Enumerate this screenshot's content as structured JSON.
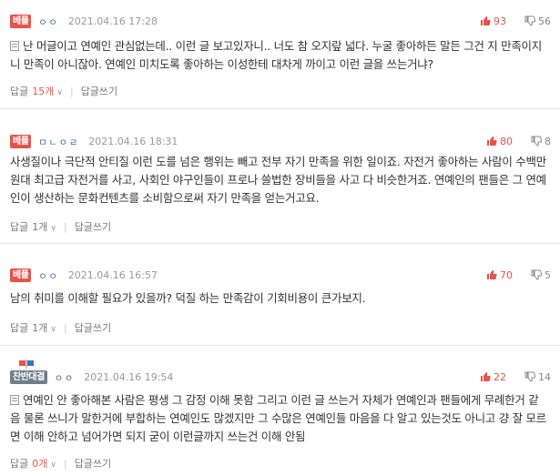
{
  "comments": [
    {
      "badge": "베플",
      "nick": "ㅇㅇ",
      "date": "2021.04.16 17:28",
      "up": "93",
      "down": "56",
      "text": "난 머글이고 연예인 관심없는데.. 이런 글 보고있자니.. 너도 참 오지랖 넓다. 누굴 좋아하든 말든 그건 지 만족이지 니 만족이 아니잖아. 연예인 미치도록 좋아하는 이성한테 대차게 까이고 이런 글을 쓰는거냐?",
      "reply_label": "답글",
      "reply_count": "15개",
      "write_label": "답글쓰기"
    },
    {
      "badge": "베플",
      "nick": "ㅁㄴㅇㄹ",
      "date": "2021.04.16 18:31",
      "up": "80",
      "down": "8",
      "text": "사생질이나 극단적 안티질 이런 도를 넘은 행위는 빼고 전부 자기 만족을 위한 일이죠. 자전거 좋아하는 사람이 수백만원대 최고급 자전거를 사고, 사회인 야구인들이 프로나 쓸법한 장비들을 사고 다 비슷한거죠. 연예인의 팬들은 그 연예인이 생산하는 문화컨텐츠를 소비함으로써 자기 만족을 얻는거고요.",
      "reply_label": "답글",
      "reply_count": "1개",
      "write_label": "답글쓰기"
    },
    {
      "badge": "베플",
      "nick": "ㅇㅇ",
      "date": "2021.04.16 16:57",
      "up": "70",
      "down": "5",
      "text": "남의 취미를 이해할 필요가 있을까? 덕질 하는 만족감이 기회비용이 큰가보지.",
      "reply_label": "답글",
      "reply_count": "1개",
      "write_label": "답글쓰기"
    },
    {
      "badge": "찬반대결",
      "nick": "ㅇㅇ",
      "date": "2021.04.16 19:54",
      "up": "22",
      "down": "14",
      "text": "연예인 안 좋아해본 사람은 평생 그 감정 이해 못함 그리고 이런 글 쓰는거 자체가 연예인과 팬들에게 무례한거 같음 물론 쓰니가 말한거에 부합하는 연예인도 많겠지만 그 수많은 연예인들 마음을 다 알고 있는것도 아니고 걍 잘 모르면 이해 안하고 넘어가면 되지 굳이 이런글까지 쓰는건 이해 안됨",
      "reply_label": "답글",
      "reply_count": "0개",
      "write_label": "답글쓰기"
    }
  ]
}
